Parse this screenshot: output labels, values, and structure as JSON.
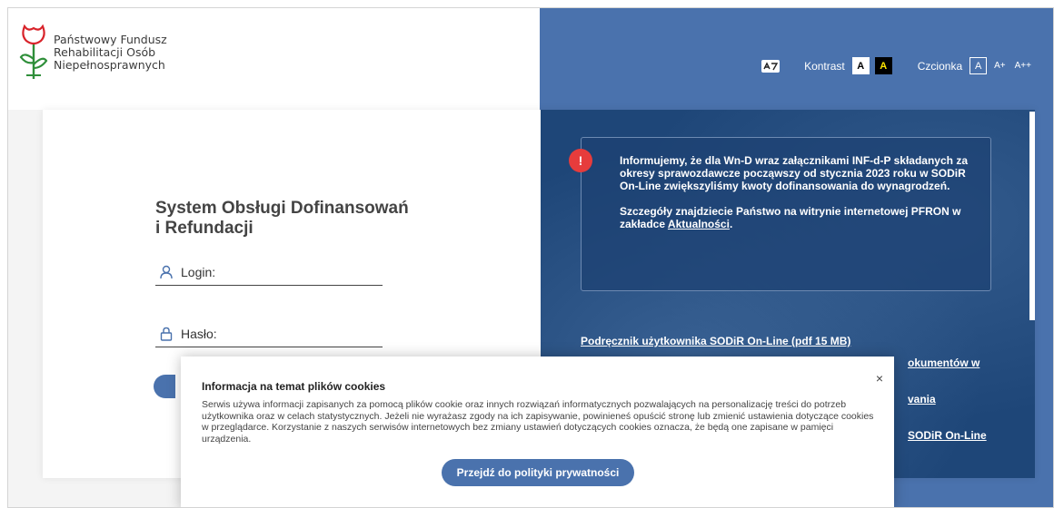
{
  "logo": {
    "lines": [
      "Państwowy Fundusz",
      "Rehabilitacji Osób",
      "Niepełnosprawnych"
    ],
    "colors": {
      "red": "#d8232a",
      "green": "#2f8f3a"
    }
  },
  "toolbar": {
    "sign_language_icon": "sign-language-icon",
    "contrast_label": "Kontrast",
    "contrast_normal": "A",
    "contrast_high": "A",
    "font_label": "Czcionka",
    "font_normal": "A",
    "font_large": "A+",
    "font_xlarge": "A++"
  },
  "login": {
    "title_line1": "System Obsługi Dofinansowań",
    "title_line2": "i Refundacji",
    "login_placeholder": "Login:",
    "password_placeholder": "Hasło:"
  },
  "notice": {
    "icon": "!",
    "paragraph1": "Informujemy, że dla Wn-D wraz załącznikami INF-d-P składanych za okresy sprawozdawcze począwszy od stycznia 2023 roku w SODiR On-Line zwiększyliśmy kwoty dofinansowania do wynagrodzeń.",
    "paragraph2_prefix": "Szczegóły znajdziecie Państwo na witrynie internetowej PFRON w zakładce ",
    "paragraph2_link": "Aktualności",
    "paragraph2_suffix": "."
  },
  "links": {
    "manual": "Podręcznik użytkownika SODiR On-Line (pdf 15 MB)",
    "partial1": "okumentów w",
    "partial2": "vania",
    "partial3": "SODiR On-Line"
  },
  "cookie": {
    "title": "Informacja na temat plików cookies",
    "text": "Serwis używa informacji zapisanych za pomocą plików cookie oraz innych rozwiązań informatycznych pozwalających na personalizację treści do potrzeb użytkownika oraz w celach statystycznych. Jeżeli nie wyrażasz zgody na ich zapisywanie, powinieneś opuścić stronę lub zmienić ustawienia dotyczące cookies w przeglądarce. Korzystanie z naszych serwisów internetowych bez zmiany ustawień dotyczących cookies oznacza, że będą one zapisane w pamięci urządzenia.",
    "close": "×",
    "button": "Przejdź do polityki prywatności"
  },
  "colors": {
    "header_blue": "#4a72ad",
    "panel_navy": "#1e4678",
    "alert_red": "#e63c3c"
  }
}
